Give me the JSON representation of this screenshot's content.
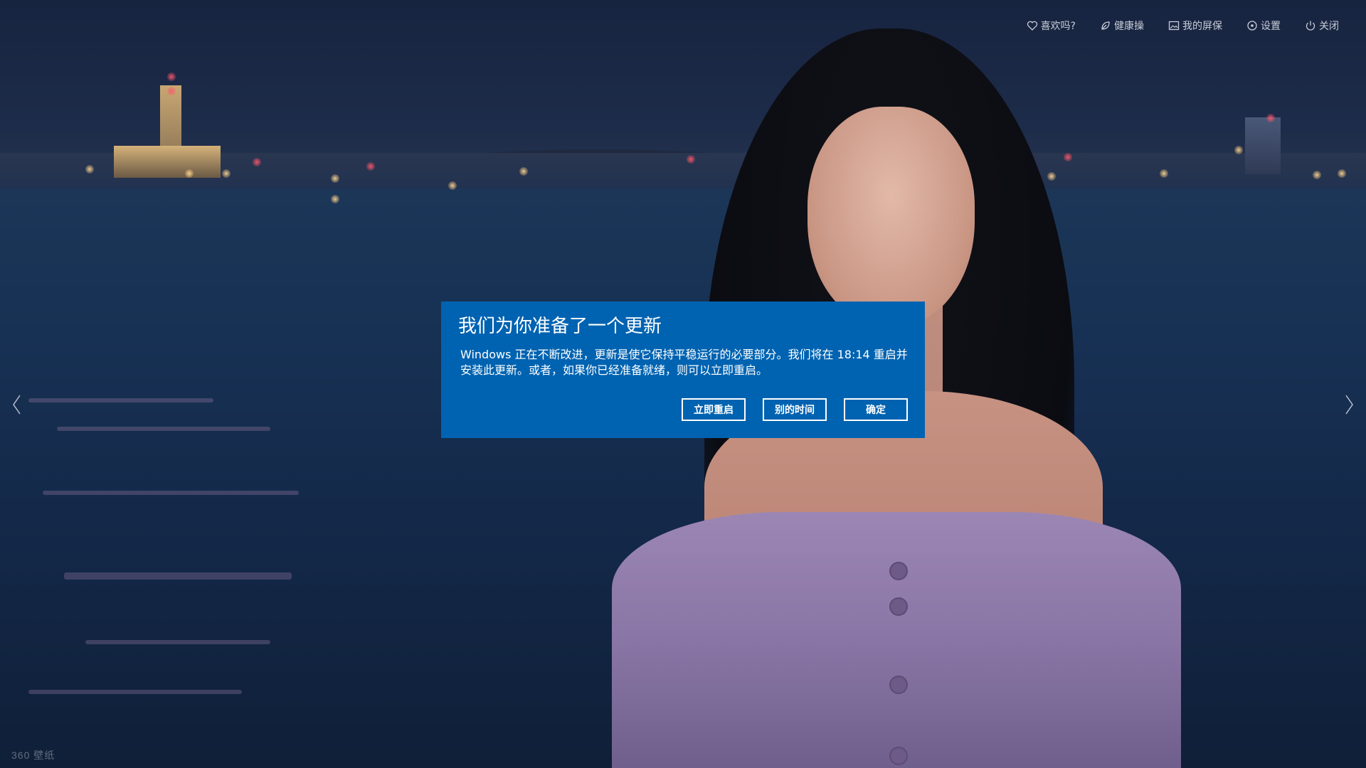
{
  "toolbar": {
    "items": [
      {
        "label": "喜欢吗?",
        "icon": "heart-icon"
      },
      {
        "label": "健康操",
        "icon": "leaf-icon"
      },
      {
        "label": "我的屏保",
        "icon": "image-icon"
      },
      {
        "label": "设置",
        "icon": "settings-icon"
      },
      {
        "label": "关闭",
        "icon": "power-icon"
      }
    ]
  },
  "dialog": {
    "title": "我们为你准备了一个更新",
    "body": "Windows 正在不断改进，更新是使它保持平稳运行的必要部分。我们将在 18:14 重启并安装此更新。或者，如果你已经准备就绪，则可以立即重启。",
    "buttons": {
      "restart_now": "立即重启",
      "other_time": "别的时间",
      "ok": "确定"
    },
    "background_color": "#0063b1"
  },
  "navigation": {
    "prev_icon": "chevron-left-icon",
    "next_icon": "chevron-right-icon"
  },
  "watermark": {
    "text": "360 壁纸"
  }
}
